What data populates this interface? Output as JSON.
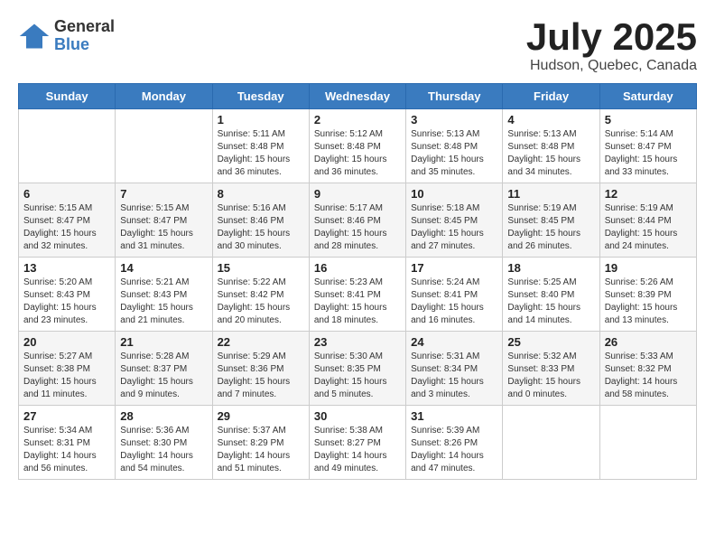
{
  "header": {
    "logo_general": "General",
    "logo_blue": "Blue",
    "month_title": "July 2025",
    "location": "Hudson, Quebec, Canada"
  },
  "days_of_week": [
    "Sunday",
    "Monday",
    "Tuesday",
    "Wednesday",
    "Thursday",
    "Friday",
    "Saturday"
  ],
  "weeks": [
    [
      {
        "day": "",
        "info": ""
      },
      {
        "day": "",
        "info": ""
      },
      {
        "day": "1",
        "info": "Sunrise: 5:11 AM\nSunset: 8:48 PM\nDaylight: 15 hours and 36 minutes."
      },
      {
        "day": "2",
        "info": "Sunrise: 5:12 AM\nSunset: 8:48 PM\nDaylight: 15 hours and 36 minutes."
      },
      {
        "day": "3",
        "info": "Sunrise: 5:13 AM\nSunset: 8:48 PM\nDaylight: 15 hours and 35 minutes."
      },
      {
        "day": "4",
        "info": "Sunrise: 5:13 AM\nSunset: 8:48 PM\nDaylight: 15 hours and 34 minutes."
      },
      {
        "day": "5",
        "info": "Sunrise: 5:14 AM\nSunset: 8:47 PM\nDaylight: 15 hours and 33 minutes."
      }
    ],
    [
      {
        "day": "6",
        "info": "Sunrise: 5:15 AM\nSunset: 8:47 PM\nDaylight: 15 hours and 32 minutes."
      },
      {
        "day": "7",
        "info": "Sunrise: 5:15 AM\nSunset: 8:47 PM\nDaylight: 15 hours and 31 minutes."
      },
      {
        "day": "8",
        "info": "Sunrise: 5:16 AM\nSunset: 8:46 PM\nDaylight: 15 hours and 30 minutes."
      },
      {
        "day": "9",
        "info": "Sunrise: 5:17 AM\nSunset: 8:46 PM\nDaylight: 15 hours and 28 minutes."
      },
      {
        "day": "10",
        "info": "Sunrise: 5:18 AM\nSunset: 8:45 PM\nDaylight: 15 hours and 27 minutes."
      },
      {
        "day": "11",
        "info": "Sunrise: 5:19 AM\nSunset: 8:45 PM\nDaylight: 15 hours and 26 minutes."
      },
      {
        "day": "12",
        "info": "Sunrise: 5:19 AM\nSunset: 8:44 PM\nDaylight: 15 hours and 24 minutes."
      }
    ],
    [
      {
        "day": "13",
        "info": "Sunrise: 5:20 AM\nSunset: 8:43 PM\nDaylight: 15 hours and 23 minutes."
      },
      {
        "day": "14",
        "info": "Sunrise: 5:21 AM\nSunset: 8:43 PM\nDaylight: 15 hours and 21 minutes."
      },
      {
        "day": "15",
        "info": "Sunrise: 5:22 AM\nSunset: 8:42 PM\nDaylight: 15 hours and 20 minutes."
      },
      {
        "day": "16",
        "info": "Sunrise: 5:23 AM\nSunset: 8:41 PM\nDaylight: 15 hours and 18 minutes."
      },
      {
        "day": "17",
        "info": "Sunrise: 5:24 AM\nSunset: 8:41 PM\nDaylight: 15 hours and 16 minutes."
      },
      {
        "day": "18",
        "info": "Sunrise: 5:25 AM\nSunset: 8:40 PM\nDaylight: 15 hours and 14 minutes."
      },
      {
        "day": "19",
        "info": "Sunrise: 5:26 AM\nSunset: 8:39 PM\nDaylight: 15 hours and 13 minutes."
      }
    ],
    [
      {
        "day": "20",
        "info": "Sunrise: 5:27 AM\nSunset: 8:38 PM\nDaylight: 15 hours and 11 minutes."
      },
      {
        "day": "21",
        "info": "Sunrise: 5:28 AM\nSunset: 8:37 PM\nDaylight: 15 hours and 9 minutes."
      },
      {
        "day": "22",
        "info": "Sunrise: 5:29 AM\nSunset: 8:36 PM\nDaylight: 15 hours and 7 minutes."
      },
      {
        "day": "23",
        "info": "Sunrise: 5:30 AM\nSunset: 8:35 PM\nDaylight: 15 hours and 5 minutes."
      },
      {
        "day": "24",
        "info": "Sunrise: 5:31 AM\nSunset: 8:34 PM\nDaylight: 15 hours and 3 minutes."
      },
      {
        "day": "25",
        "info": "Sunrise: 5:32 AM\nSunset: 8:33 PM\nDaylight: 15 hours and 0 minutes."
      },
      {
        "day": "26",
        "info": "Sunrise: 5:33 AM\nSunset: 8:32 PM\nDaylight: 14 hours and 58 minutes."
      }
    ],
    [
      {
        "day": "27",
        "info": "Sunrise: 5:34 AM\nSunset: 8:31 PM\nDaylight: 14 hours and 56 minutes."
      },
      {
        "day": "28",
        "info": "Sunrise: 5:36 AM\nSunset: 8:30 PM\nDaylight: 14 hours and 54 minutes."
      },
      {
        "day": "29",
        "info": "Sunrise: 5:37 AM\nSunset: 8:29 PM\nDaylight: 14 hours and 51 minutes."
      },
      {
        "day": "30",
        "info": "Sunrise: 5:38 AM\nSunset: 8:27 PM\nDaylight: 14 hours and 49 minutes."
      },
      {
        "day": "31",
        "info": "Sunrise: 5:39 AM\nSunset: 8:26 PM\nDaylight: 14 hours and 47 minutes."
      },
      {
        "day": "",
        "info": ""
      },
      {
        "day": "",
        "info": ""
      }
    ]
  ]
}
